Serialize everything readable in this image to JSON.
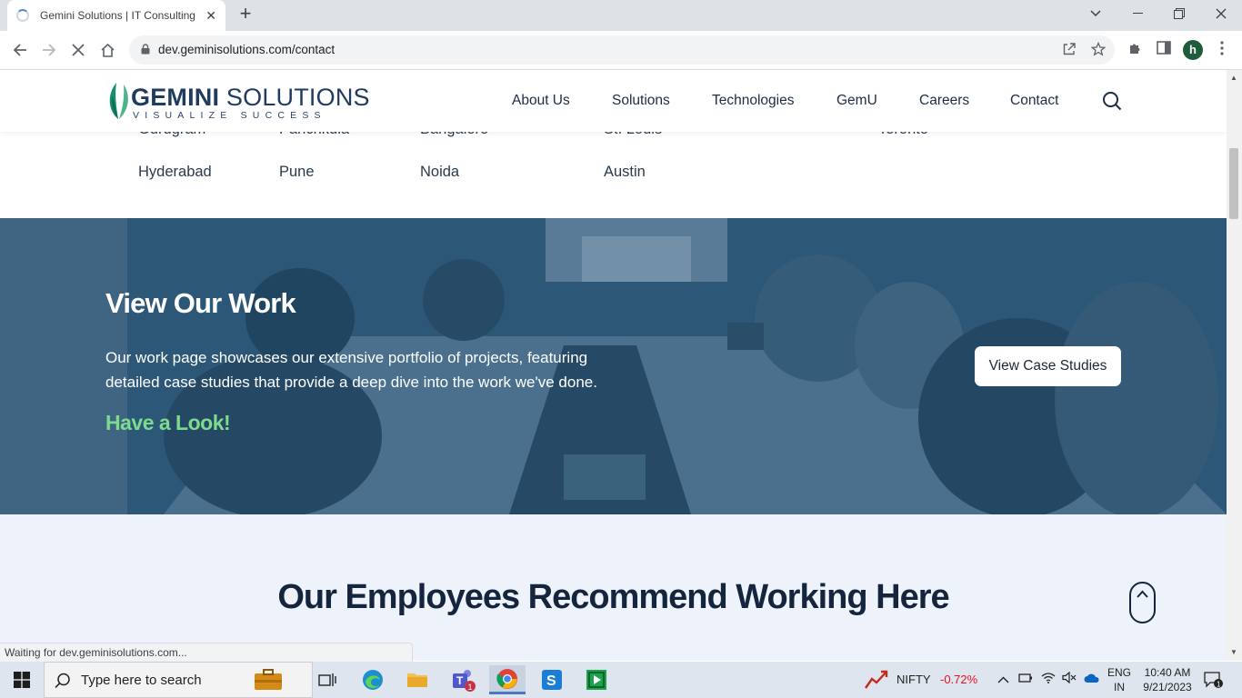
{
  "browser": {
    "tab_title": "Gemini Solutions | IT Consulting",
    "url": "dev.geminisolutions.com/contact",
    "status_text": "Waiting for dev.geminisolutions.com...",
    "profile_initial": "h"
  },
  "site": {
    "logo_word1": "GEMINI",
    "logo_word2": "SOLUTIONS",
    "logo_tagline": "VISUALIZE SUCCESS",
    "nav": [
      "About Us",
      "Solutions",
      "Technologies",
      "GemU",
      "Careers",
      "Contact"
    ]
  },
  "locations": {
    "row1": [
      "Gurugram",
      "Panchkula",
      "Bangalore",
      "St. Louis",
      "Toronto"
    ],
    "row2": [
      "Hyderabad",
      "Pune",
      "Noida",
      "Austin"
    ]
  },
  "work": {
    "heading": "View Our Work",
    "body": "Our work page showcases our extensive portfolio of projects, featuring detailed case studies that provide a deep dive into the work we've done.",
    "look_label": "Have a Look!",
    "cta_label": "View Case Studies"
  },
  "recommend": {
    "heading": "Our Employees Recommend Working Here"
  },
  "taskbar": {
    "search_placeholder": "Type here to search",
    "stock_name": "NIFTY",
    "stock_change": "-0.72%",
    "lang_line1": "ENG",
    "lang_line2": "IN",
    "time": "10:40 AM",
    "date": "9/21/2023",
    "notification_count": "1",
    "teams_badge": "1"
  },
  "colors": {
    "accent_green": "#7ddb8e",
    "heading_navy": "#14253d",
    "stock_negative": "#e81123"
  }
}
